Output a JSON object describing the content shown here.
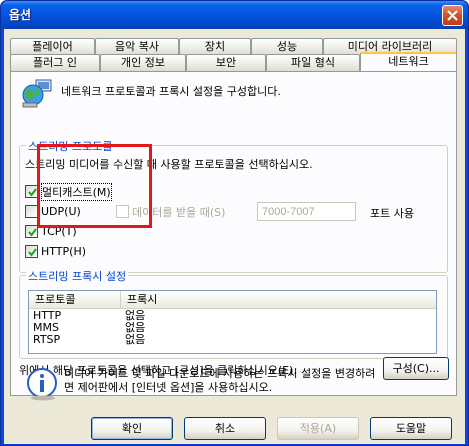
{
  "window": {
    "title": "옵션"
  },
  "tabs_back": [
    "플레이어",
    "음악 복사",
    "장치",
    "성능",
    "미디어 라이브러리"
  ],
  "tabs_front": [
    "플러그 인",
    "개인 정보",
    "보안",
    "파일 형식",
    "네트워크"
  ],
  "active_tab": "네트워크",
  "intro": "네트워크 프로토콜과 프록시 설정을 구성합니다.",
  "streaming_protocols": {
    "title": "스트리밍 프로토콜",
    "description": "스트리밍 미디어를 수신할 때 사용할 프로토콜을 선택하십시오.",
    "multicast_label": "멀티캐스트(M)",
    "udp_label": "UDP(U)",
    "tcp_label": "TCP(T)",
    "http_label": "HTTP(H)",
    "receive_data_label": "데이터를 받을 때(S)",
    "port_range_value": "7000-7007",
    "port_suffix": "포트 사용",
    "checked": {
      "multicast": true,
      "udp": false,
      "tcp": true,
      "http": true,
      "receive_data": false
    }
  },
  "proxy_settings": {
    "title": "스트리밍 프록시 설정",
    "columns": [
      "프로토콜",
      "프록시"
    ],
    "rows": [
      {
        "protocol": "HTTP",
        "proxy": "없음"
      },
      {
        "protocol": "MMS",
        "proxy": "없음"
      },
      {
        "protocol": "RTSP",
        "proxy": "없음"
      }
    ],
    "hint": "위에서 해당 프로토콜을 선택하고 [구성]을 클릭하십시오(E).",
    "configure_button": "구성(C)..."
  },
  "info_text_line1": "미디어 가이드 및 파일 다운로드에 사용하는 프록시 설정을 변경하려",
  "info_text_line2": "면 제어판에서 [인터넷 옵션]을 사용하십시오.",
  "buttons": {
    "ok": "확인",
    "cancel": "취소",
    "apply": "적용(A)",
    "help": "도움말"
  },
  "colors": {
    "title_bar": "#0451dd",
    "group_title": "#0046d5",
    "highlight": "#e2161b"
  }
}
